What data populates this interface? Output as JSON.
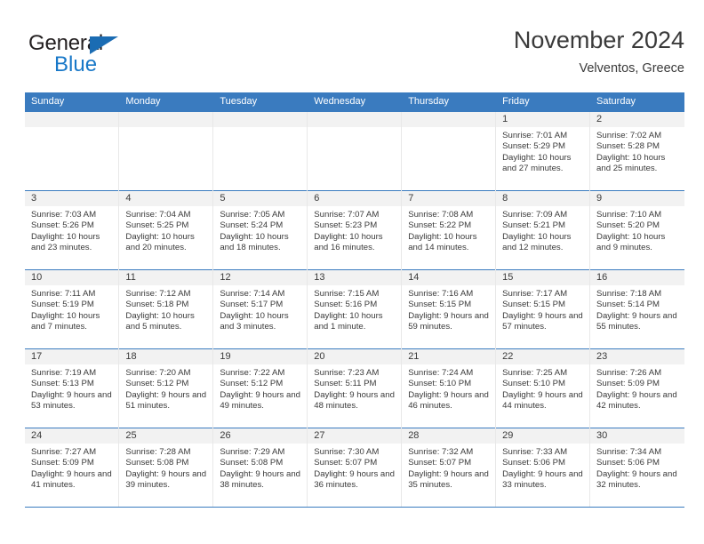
{
  "brand": {
    "name_part1": "General",
    "name_part2": "Blue",
    "colors": {
      "dark": "#231F20",
      "blue": "#1878C8"
    }
  },
  "header": {
    "title": "November 2024",
    "subtitle": "Velventos, Greece"
  },
  "theme": {
    "header_blue": "#3A7BBF",
    "daynum_gray": "#F2F2F2",
    "text": "#3A3A3A"
  },
  "weekdays": [
    "Sunday",
    "Monday",
    "Tuesday",
    "Wednesday",
    "Thursday",
    "Friday",
    "Saturday"
  ],
  "weeks": [
    [
      {
        "date": "",
        "empty": true
      },
      {
        "date": "",
        "empty": true
      },
      {
        "date": "",
        "empty": true
      },
      {
        "date": "",
        "empty": true
      },
      {
        "date": "",
        "empty": true
      },
      {
        "date": "1",
        "sunrise": "Sunrise: 7:01 AM",
        "sunset": "Sunset: 5:29 PM",
        "daylight": "Daylight: 10 hours and 27 minutes."
      },
      {
        "date": "2",
        "sunrise": "Sunrise: 7:02 AM",
        "sunset": "Sunset: 5:28 PM",
        "daylight": "Daylight: 10 hours and 25 minutes."
      }
    ],
    [
      {
        "date": "3",
        "sunrise": "Sunrise: 7:03 AM",
        "sunset": "Sunset: 5:26 PM",
        "daylight": "Daylight: 10 hours and 23 minutes."
      },
      {
        "date": "4",
        "sunrise": "Sunrise: 7:04 AM",
        "sunset": "Sunset: 5:25 PM",
        "daylight": "Daylight: 10 hours and 20 minutes."
      },
      {
        "date": "5",
        "sunrise": "Sunrise: 7:05 AM",
        "sunset": "Sunset: 5:24 PM",
        "daylight": "Daylight: 10 hours and 18 minutes."
      },
      {
        "date": "6",
        "sunrise": "Sunrise: 7:07 AM",
        "sunset": "Sunset: 5:23 PM",
        "daylight": "Daylight: 10 hours and 16 minutes."
      },
      {
        "date": "7",
        "sunrise": "Sunrise: 7:08 AM",
        "sunset": "Sunset: 5:22 PM",
        "daylight": "Daylight: 10 hours and 14 minutes."
      },
      {
        "date": "8",
        "sunrise": "Sunrise: 7:09 AM",
        "sunset": "Sunset: 5:21 PM",
        "daylight": "Daylight: 10 hours and 12 minutes."
      },
      {
        "date": "9",
        "sunrise": "Sunrise: 7:10 AM",
        "sunset": "Sunset: 5:20 PM",
        "daylight": "Daylight: 10 hours and 9 minutes."
      }
    ],
    [
      {
        "date": "10",
        "sunrise": "Sunrise: 7:11 AM",
        "sunset": "Sunset: 5:19 PM",
        "daylight": "Daylight: 10 hours and 7 minutes."
      },
      {
        "date": "11",
        "sunrise": "Sunrise: 7:12 AM",
        "sunset": "Sunset: 5:18 PM",
        "daylight": "Daylight: 10 hours and 5 minutes."
      },
      {
        "date": "12",
        "sunrise": "Sunrise: 7:14 AM",
        "sunset": "Sunset: 5:17 PM",
        "daylight": "Daylight: 10 hours and 3 minutes."
      },
      {
        "date": "13",
        "sunrise": "Sunrise: 7:15 AM",
        "sunset": "Sunset: 5:16 PM",
        "daylight": "Daylight: 10 hours and 1 minute."
      },
      {
        "date": "14",
        "sunrise": "Sunrise: 7:16 AM",
        "sunset": "Sunset: 5:15 PM",
        "daylight": "Daylight: 9 hours and 59 minutes."
      },
      {
        "date": "15",
        "sunrise": "Sunrise: 7:17 AM",
        "sunset": "Sunset: 5:15 PM",
        "daylight": "Daylight: 9 hours and 57 minutes."
      },
      {
        "date": "16",
        "sunrise": "Sunrise: 7:18 AM",
        "sunset": "Sunset: 5:14 PM",
        "daylight": "Daylight: 9 hours and 55 minutes."
      }
    ],
    [
      {
        "date": "17",
        "sunrise": "Sunrise: 7:19 AM",
        "sunset": "Sunset: 5:13 PM",
        "daylight": "Daylight: 9 hours and 53 minutes."
      },
      {
        "date": "18",
        "sunrise": "Sunrise: 7:20 AM",
        "sunset": "Sunset: 5:12 PM",
        "daylight": "Daylight: 9 hours and 51 minutes."
      },
      {
        "date": "19",
        "sunrise": "Sunrise: 7:22 AM",
        "sunset": "Sunset: 5:12 PM",
        "daylight": "Daylight: 9 hours and 49 minutes."
      },
      {
        "date": "20",
        "sunrise": "Sunrise: 7:23 AM",
        "sunset": "Sunset: 5:11 PM",
        "daylight": "Daylight: 9 hours and 48 minutes."
      },
      {
        "date": "21",
        "sunrise": "Sunrise: 7:24 AM",
        "sunset": "Sunset: 5:10 PM",
        "daylight": "Daylight: 9 hours and 46 minutes."
      },
      {
        "date": "22",
        "sunrise": "Sunrise: 7:25 AM",
        "sunset": "Sunset: 5:10 PM",
        "daylight": "Daylight: 9 hours and 44 minutes."
      },
      {
        "date": "23",
        "sunrise": "Sunrise: 7:26 AM",
        "sunset": "Sunset: 5:09 PM",
        "daylight": "Daylight: 9 hours and 42 minutes."
      }
    ],
    [
      {
        "date": "24",
        "sunrise": "Sunrise: 7:27 AM",
        "sunset": "Sunset: 5:09 PM",
        "daylight": "Daylight: 9 hours and 41 minutes."
      },
      {
        "date": "25",
        "sunrise": "Sunrise: 7:28 AM",
        "sunset": "Sunset: 5:08 PM",
        "daylight": "Daylight: 9 hours and 39 minutes."
      },
      {
        "date": "26",
        "sunrise": "Sunrise: 7:29 AM",
        "sunset": "Sunset: 5:08 PM",
        "daylight": "Daylight: 9 hours and 38 minutes."
      },
      {
        "date": "27",
        "sunrise": "Sunrise: 7:30 AM",
        "sunset": "Sunset: 5:07 PM",
        "daylight": "Daylight: 9 hours and 36 minutes."
      },
      {
        "date": "28",
        "sunrise": "Sunrise: 7:32 AM",
        "sunset": "Sunset: 5:07 PM",
        "daylight": "Daylight: 9 hours and 35 minutes."
      },
      {
        "date": "29",
        "sunrise": "Sunrise: 7:33 AM",
        "sunset": "Sunset: 5:06 PM",
        "daylight": "Daylight: 9 hours and 33 minutes."
      },
      {
        "date": "30",
        "sunrise": "Sunrise: 7:34 AM",
        "sunset": "Sunset: 5:06 PM",
        "daylight": "Daylight: 9 hours and 32 minutes."
      }
    ]
  ]
}
